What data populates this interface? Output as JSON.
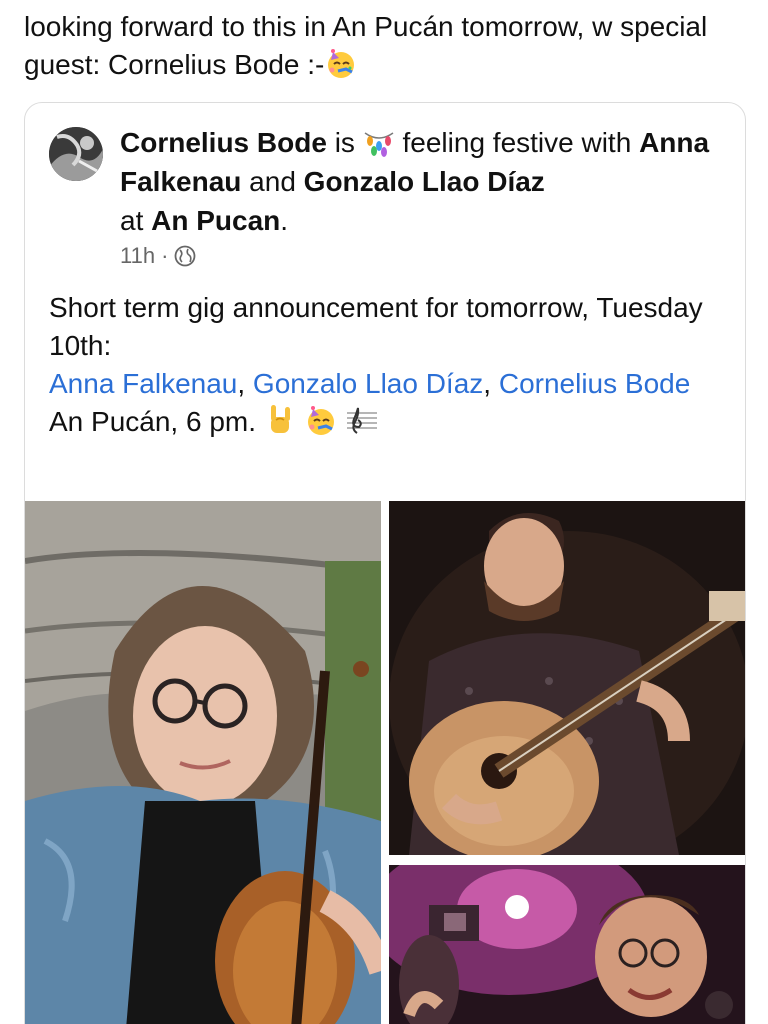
{
  "post": {
    "text": "looking forward to this in An Pucán tomorrow, w special guest: Cornelius Bode :-"
  },
  "shared_card": {
    "author": "Cornelius Bode",
    "is": "is",
    "feeling": "feeling festive with",
    "tag1": "Anna Falkenau",
    "and": "and",
    "tag2": "Gonzalo Llao Díaz",
    "at": "at",
    "place": "An Pucan",
    "period": ".",
    "time": "11h",
    "dot": "·",
    "body_line1": "Short term gig announcement for tomorrow, Tuesday 10th:",
    "mention1": "Anna Falkenau",
    "comma1": ", ",
    "mention2": "Gonzalo Llao Díaz",
    "comma2": ", ",
    "mention3": "Cornelius Bode",
    "venue_line": "An Pucán, 6 pm."
  },
  "icons": {
    "face": "partying-face-icon",
    "globe": "globe-icon",
    "lights": "string-lights-icon",
    "rock": "rock-on-hand-icon",
    "music": "musical-score-icon"
  },
  "colors": {
    "link": "#2b6fd6",
    "meta": "#666666",
    "border": "#dcdcdc"
  }
}
